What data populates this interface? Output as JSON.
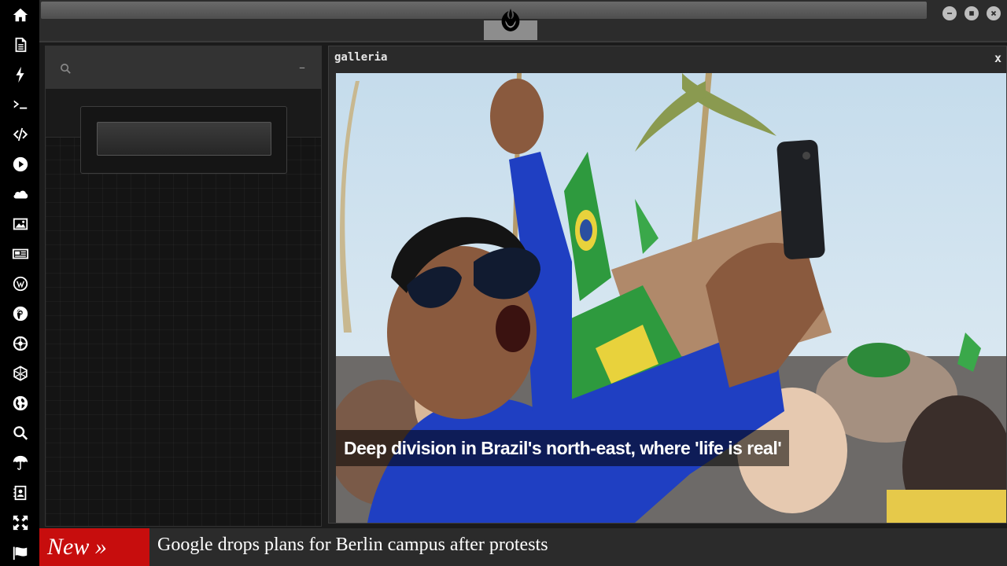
{
  "sidebar": {
    "icons": [
      "home-icon",
      "document-icon",
      "bolt-icon",
      "terminal-icon",
      "code-icon",
      "play-icon",
      "cloud-icon",
      "image-icon",
      "newspaper-icon",
      "wordpress-icon",
      "pinterest-icon",
      "rebel-alliance-icon",
      "network-icon",
      "globe-icon",
      "search-icon",
      "umbrella-icon",
      "contacts-icon",
      "expand-icon",
      "flag-icon"
    ]
  },
  "topbar": {
    "logo": "rebel-alliance-logo",
    "window_controls": [
      "minimize-icon",
      "maximize-icon",
      "close-icon"
    ]
  },
  "search_panel": {
    "search_icon": "search-icon",
    "minimize_label": "–",
    "query": ""
  },
  "gallery": {
    "title": "galleria",
    "close_label": "x",
    "caption": "Deep division in Brazil's north-east, where 'life is real'"
  },
  "ticker": {
    "label": "New »",
    "headline": "Google drops plans for Berlin campus after protests"
  },
  "colors": {
    "ticker_label_bg": "#c70d0d",
    "sidebar_bg": "#000000",
    "panel_bg": "#141414"
  }
}
